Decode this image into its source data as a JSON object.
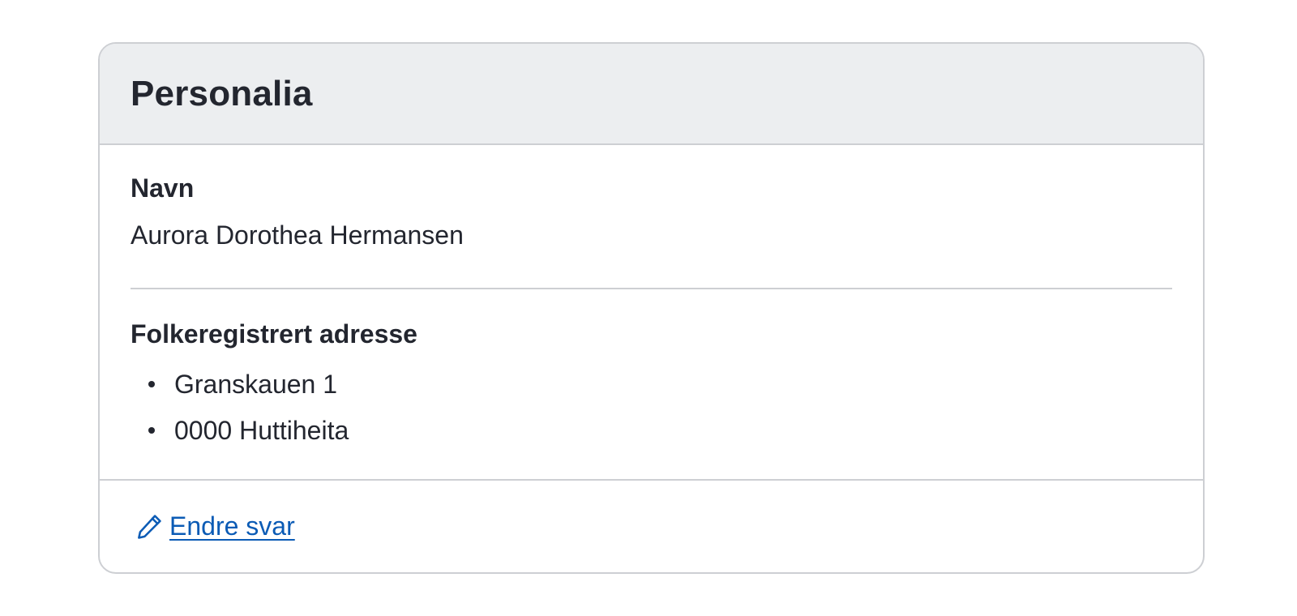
{
  "card": {
    "title": "Personalia",
    "fields": {
      "name": {
        "label": "Navn",
        "value": "Aurora Dorothea Hermansen"
      },
      "address": {
        "label": "Folkeregistrert adresse",
        "lines": [
          "Granskauen 1",
          "0000 Huttiheita"
        ]
      }
    },
    "footer": {
      "edit_label": "Endre svar",
      "edit_icon": "pencil-icon"
    }
  },
  "colors": {
    "text": "#23262f",
    "header_bg": "#eceef0",
    "border": "#cdcfd3",
    "link": "#0b5bb5"
  }
}
